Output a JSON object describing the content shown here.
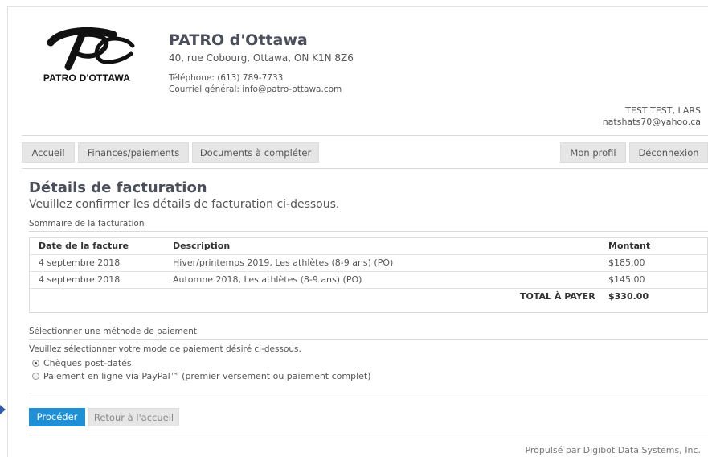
{
  "org": {
    "logo_text": "PATRO D'OTTAWA",
    "name": "PATRO d'Ottawa",
    "address": "40, rue Cobourg, Ottawa, ON K1N 8Z6",
    "phone": "Téléphone: (613) 789-7733",
    "email": "Courriel général: info@patro-ottawa.com"
  },
  "user": {
    "name": "TEST TEST, LARS",
    "email": "natshats70@yahoo.ca"
  },
  "nav": {
    "home": "Accueil",
    "finances": "Finances/paiements",
    "documents": "Documents à compléter",
    "profile": "Mon profil",
    "logout": "Déconnexion"
  },
  "page": {
    "title": "Détails de facturation",
    "subtitle": "Veuillez confirmer les détails de facturation ci-dessous."
  },
  "summary": {
    "label": "Sommaire de la facturation",
    "headers": {
      "date": "Date de la facture",
      "description": "Description",
      "amount": "Montant"
    },
    "rows": [
      {
        "date": "4 septembre 2018",
        "description": "Hiver/printemps 2019, Les athlètes (8-9 ans) (PO)",
        "amount": "$185.00"
      },
      {
        "date": "4 septembre 2018",
        "description": "Automne 2018, Les athlètes (8-9 ans) (PO)",
        "amount": "$145.00"
      }
    ],
    "total_label": "TOTAL À PAYER",
    "total_value": "$330.00"
  },
  "payment": {
    "label": "Sélectionner une méthode de paiement",
    "instructions": "Veuillez sélectionner votre mode de paiement désiré ci-dessous.",
    "options": [
      {
        "label": "Chèques post-datés",
        "selected": true
      },
      {
        "label": "Paiement en ligne via PayPal™ (premier versement ou paiement complet)",
        "selected": false
      }
    ]
  },
  "actions": {
    "proceed": "Procéder",
    "back": "Retour à l'accueil"
  },
  "footer": {
    "text": "Propulsé par Digibot Data Systems, Inc."
  },
  "colors": {
    "primary_button": "#1f8fd6",
    "nav_button": "#e6e6e6",
    "edge_marker": "#2f5aa8"
  }
}
